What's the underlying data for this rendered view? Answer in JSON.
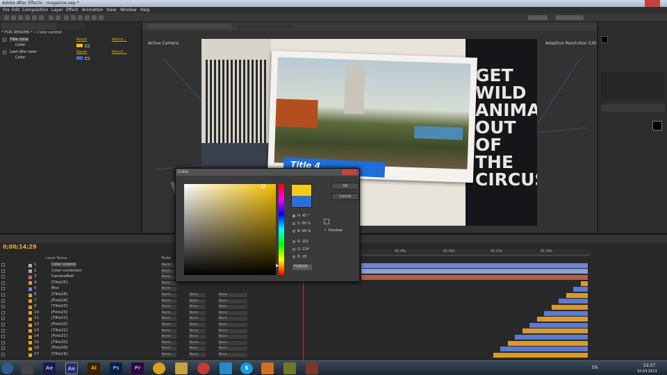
{
  "window": {
    "title": "Adobe After Effects - magazine.aep *"
  },
  "menu": [
    "File",
    "Edit",
    "Composition",
    "Layer",
    "Effect",
    "Animation",
    "View",
    "Window",
    "Help"
  ],
  "effect_controls": {
    "header": "* FOR RENDER * • Color control",
    "rows": [
      {
        "label": "Title color",
        "reset": "Reset",
        "about": "About..."
      },
      {
        "label": "Color"
      },
      {
        "label": "Last title color",
        "reset": "Reset",
        "about": "About..."
      },
      {
        "label": "Color"
      }
    ],
    "colors": {
      "title": "#f3c000",
      "last": "#2a6fd6"
    }
  },
  "viewer": {
    "camera": "Active Camera",
    "renderer": "Adaptive Resolution (LB)",
    "title_badge": "Title 4",
    "poster_words": [
      "GET",
      "WILD",
      "ANIMA",
      "OUT",
      "OF",
      "THE",
      "CIRCUS"
    ]
  },
  "timeline": {
    "timecode": "0;00;14;29",
    "column_layer_name": "Layer Name",
    "column_mode": "Mode",
    "ruler": [
      "00:45s",
      "01:00s",
      "01:15s",
      "01:30s"
    ],
    "layers": [
      {
        "n": "1",
        "name": "Color control",
        "chip": "#aaaaaa",
        "mode": "Norm",
        "p1": "",
        "p2": ""
      },
      {
        "n": "2",
        "name": "Color correction",
        "chip": "#aaaaaa",
        "mode": "Norm",
        "p1": "",
        "p2": ""
      },
      {
        "n": "3",
        "name": "CameraNull",
        "chip": "#c46a6a",
        "mode": "Norm",
        "p1": "",
        "p2": ""
      },
      {
        "n": "4",
        "name": "[Title25]",
        "chip": "#e0a030",
        "mode": "Norm",
        "p1": "",
        "p2": ""
      },
      {
        "n": "5",
        "name": "Blur",
        "chip": "#8080ff",
        "mode": "Norm",
        "p1": "",
        "p2": ""
      },
      {
        "n": "6",
        "name": "[Title24]",
        "chip": "#e0a030",
        "mode": "Norm",
        "p1": "None",
        "p2": "None"
      },
      {
        "n": "7",
        "name": "[Foto24]",
        "chip": "#e0a030",
        "mode": "Norm",
        "p1": "None",
        "p2": "None"
      },
      {
        "n": "8",
        "name": "[Title23]",
        "chip": "#e0a030",
        "mode": "Norm",
        "p1": "None",
        "p2": "None"
      },
      {
        "n": "10",
        "name": "[Foto23]",
        "chip": "#e0a030",
        "mode": "Norm",
        "p1": "None",
        "p2": "None"
      },
      {
        "n": "11",
        "name": "[Title22]",
        "chip": "#e0a030",
        "mode": "Norm",
        "p1": "None",
        "p2": "None"
      },
      {
        "n": "12",
        "name": "[Foto22]",
        "chip": "#e0a030",
        "mode": "Norm",
        "p1": "None",
        "p2": "None"
      },
      {
        "n": "13",
        "name": "[Title21]",
        "chip": "#e0a030",
        "mode": "Norm",
        "p1": "None",
        "p2": "None"
      },
      {
        "n": "14",
        "name": "[Foto21]",
        "chip": "#e0a030",
        "mode": "Norm",
        "p1": "None",
        "p2": "None"
      },
      {
        "n": "15",
        "name": "[Title20]",
        "chip": "#e0a030",
        "mode": "Norm",
        "p1": "None",
        "p2": "None"
      },
      {
        "n": "16",
        "name": "[Foto20]",
        "chip": "#e0a030",
        "mode": "Norm",
        "p1": "None",
        "p2": "None"
      },
      {
        "n": "17",
        "name": "[Title19]",
        "chip": "#e0a030",
        "mode": "Norm",
        "p1": "None",
        "p2": "None"
      }
    ]
  },
  "color_dialog": {
    "title": "Color",
    "ok": "OK",
    "cancel": "Cancel",
    "preview": "Preview",
    "H": "H: 45 °",
    "S": "S: 89 %",
    "B": "B: 99 %",
    "R": "R: 252",
    "G": "G: 224",
    "Bl": "B: 28",
    "hex": "FCE01D",
    "swatch": "#f4c81c"
  },
  "watermark": "videohive",
  "taskbar": {
    "lang": "EN",
    "time": "22:27",
    "date": "10.03.2013"
  }
}
